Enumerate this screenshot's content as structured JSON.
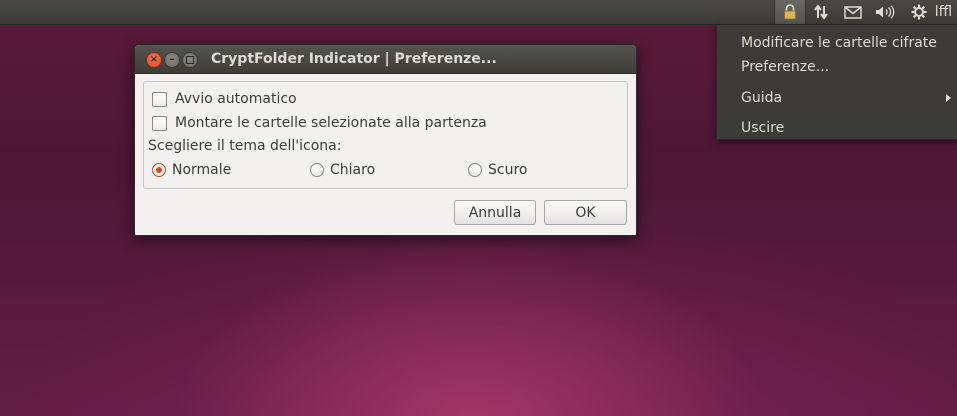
{
  "panel": {
    "indicators": [
      {
        "icon": "lock-icon"
      },
      {
        "icon": "network-icon"
      },
      {
        "icon": "mail-icon"
      },
      {
        "icon": "sound-icon"
      },
      {
        "icon": "gear-icon"
      }
    ],
    "user_label": "lffl"
  },
  "menu": {
    "items": [
      {
        "label": "Modificare le cartelle cifrate"
      },
      {
        "label": "Preferenze..."
      },
      {
        "label": "Guida",
        "has_submenu": true
      },
      {
        "label": "Uscire"
      }
    ]
  },
  "dialog": {
    "title": "CryptFolder Indicator | Preferenze...",
    "options": {
      "autostart_label": "Avvio automatico",
      "autostart_checked": false,
      "mount_label": "Montare le cartelle selezionate alla partenza",
      "mount_checked": false
    },
    "theme": {
      "label": "Scegliere il tema dell'icona:",
      "choices": [
        {
          "label": "Normale",
          "selected": true
        },
        {
          "label": "Chiaro",
          "selected": false
        },
        {
          "label": "Scuro",
          "selected": false
        }
      ]
    },
    "buttons": {
      "cancel_label": "Annulla",
      "ok_label": "OK"
    }
  },
  "colors": {
    "accent": "#dd4814",
    "panel": "#3c3b37",
    "dialog_bg": "#f2f1f0"
  }
}
